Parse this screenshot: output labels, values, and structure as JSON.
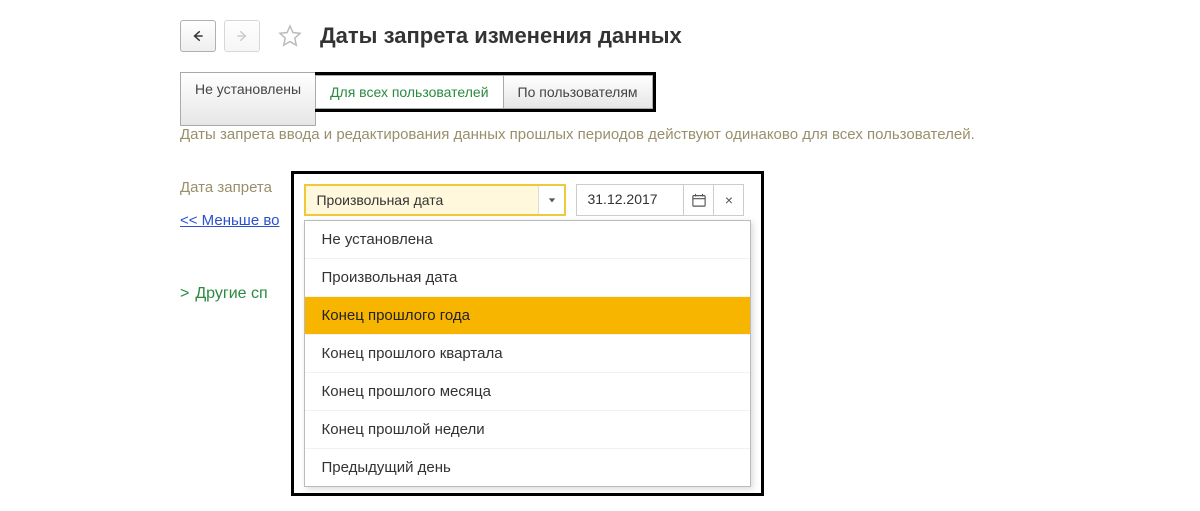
{
  "header": {
    "title": "Даты запрета изменения данных"
  },
  "tabs": {
    "not_set": "Не установлены",
    "all_users": "Для всех пользователей",
    "by_users": "По пользователям"
  },
  "description": "Даты запрета ввода и редактирования данных прошлых периодов действуют одинаково для всех пользователей.",
  "form": {
    "date_label": "Дата запрета",
    "selected_value": "Произвольная дата",
    "date_value": "31.12.2017"
  },
  "dropdown": {
    "items": [
      "Не установлена",
      "Произвольная дата",
      "Конец прошлого года",
      "Конец прошлого квартала",
      "Конец прошлого месяца",
      "Конец прошлой недели",
      "Предыдущий день"
    ],
    "highlighted_index": 2
  },
  "links": {
    "less": "<< Меньше во",
    "other": "Другие сп"
  },
  "icons": {
    "back": "back-arrow",
    "forward": "forward-arrow",
    "star": "star",
    "dropdown": "caret-down",
    "calendar": "calendar",
    "clear": "×",
    "chevron": ">"
  }
}
